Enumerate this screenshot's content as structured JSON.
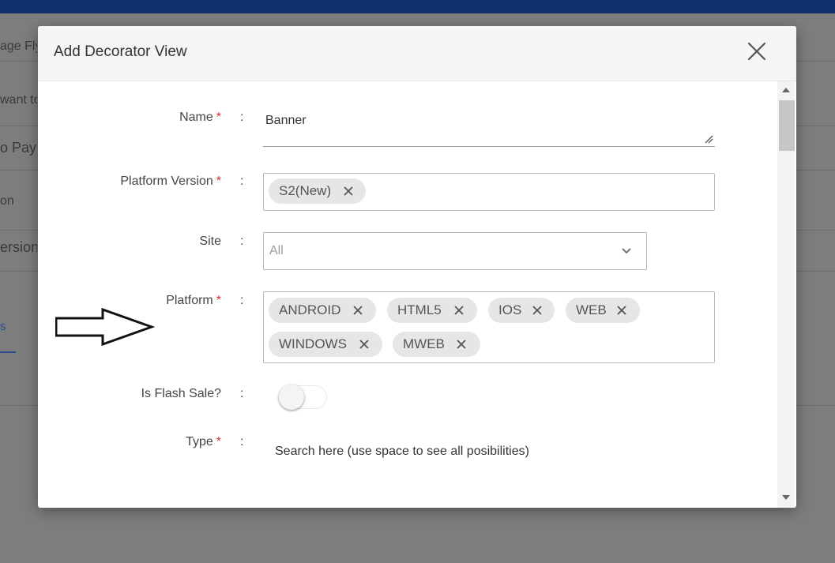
{
  "background": {
    "fragments": [
      "age Fly",
      "want to",
      "o Pay",
      "on",
      "ersion"
    ],
    "tab_fragment": "s"
  },
  "modal": {
    "title": "Add Decorator View",
    "close_icon": "close-icon",
    "fields": {
      "name": {
        "label": "Name",
        "required": "*",
        "value": "Banner"
      },
      "platform_version": {
        "label": "Platform Version",
        "required": "*",
        "chips": [
          "S2(New)"
        ]
      },
      "site": {
        "label": "Site",
        "value": "All"
      },
      "platform": {
        "label": "Platform",
        "required": "*",
        "chips": [
          "ANDROID",
          "HTML5",
          "IOS",
          "WEB",
          "WINDOWS",
          "MWEB"
        ]
      },
      "flash_sale": {
        "label": "Is Flash Sale?",
        "on": false
      },
      "type": {
        "label": "Type",
        "required": "*",
        "placeholder": "Search here (use space to see all posibilities)"
      }
    },
    "colon": ":"
  },
  "colors": {
    "topbar": "#0f2f6b",
    "required": "#d0312d",
    "chip_bg": "#e6e6e6"
  }
}
